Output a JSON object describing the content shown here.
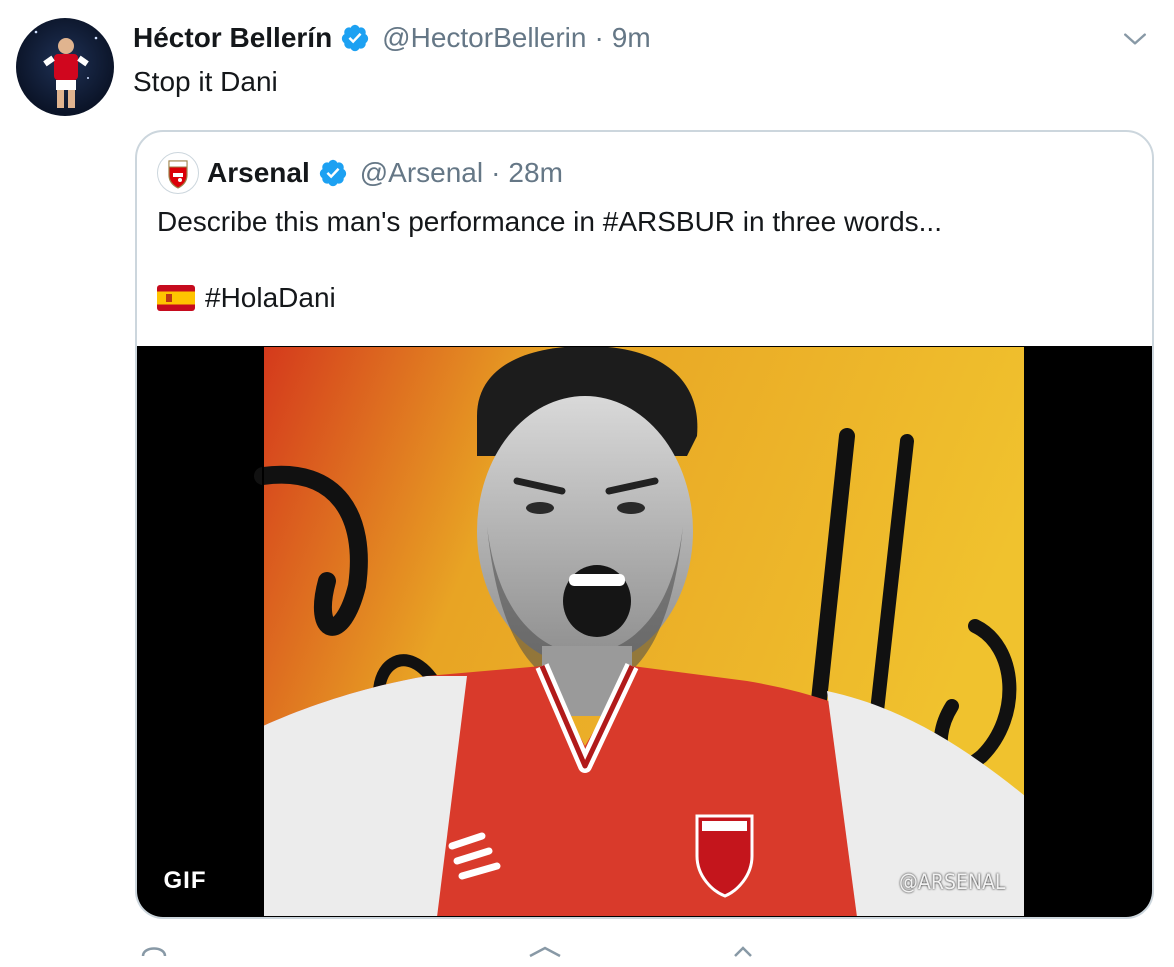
{
  "tweet": {
    "author_name": "Héctor Bellerín",
    "handle": "@HectorBellerin",
    "separator": "·",
    "time": "9m",
    "text": "Stop it Dani"
  },
  "quoted": {
    "author_name": "Arsenal",
    "handle": "@Arsenal",
    "separator": "·",
    "time": "28m",
    "text": "Describe this man's performance in #ARSBUR in three words...",
    "hashtag": "#HolaDani",
    "media_badge": "GIF",
    "watermark": "@ARSENAL"
  },
  "colors": {
    "verified": "#1da1f2",
    "arsenal_red": "#db0007"
  },
  "icons": [
    "verified-badge-icon",
    "chevron-down-icon",
    "spain-flag-icon"
  ]
}
